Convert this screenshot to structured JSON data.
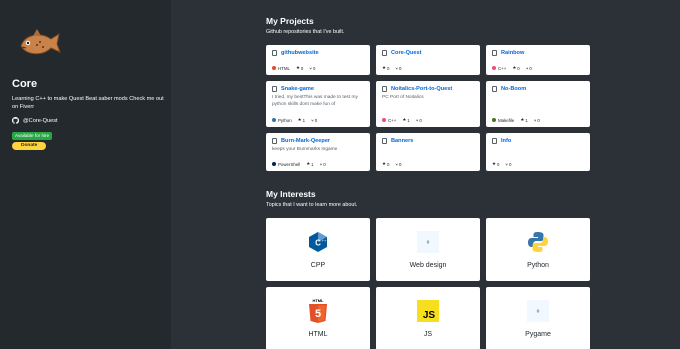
{
  "profile": {
    "name": "Core",
    "bio": "Learning C++ to make Quest Beat saber mods Check me out on Fiverr",
    "github": "@Core-Quest",
    "hire": "Available for hire",
    "donate": "Donate"
  },
  "projects": {
    "title": "My Projects",
    "subtitle": "Github repositories that I've built.",
    "items": [
      {
        "name": "githubwebsite",
        "desc": "",
        "lang": "HTML",
        "lang_color": "#e34c26",
        "stars": "0",
        "forks": "0"
      },
      {
        "name": "Core-Quest",
        "desc": "",
        "lang": "",
        "lang_color": "",
        "stars": "0",
        "forks": "0"
      },
      {
        "name": "Rainbow",
        "desc": "",
        "lang": "C++",
        "lang_color": "#f34b7d",
        "stars": "0",
        "forks": "0"
      },
      {
        "name": "Snake-game",
        "desc": "I tried, my bestThis was made to test my python skills dont make fun of",
        "lang": "Python",
        "lang_color": "#3572A5",
        "stars": "1",
        "forks": "0"
      },
      {
        "name": "Noitalics-Port-to-Quest",
        "desc": "PC Port of Noitalics",
        "lang": "C++",
        "lang_color": "#f34b7d",
        "stars": "1",
        "forks": "0"
      },
      {
        "name": "No-Boom",
        "desc": "",
        "lang": "Makefile",
        "lang_color": "#427819",
        "stars": "1",
        "forks": "0"
      },
      {
        "name": "Burn-Mark-Qeeper",
        "desc": "keeps your Burnmarks Ingame",
        "lang": "PowerShell",
        "lang_color": "#012456",
        "stars": "1",
        "forks": "0"
      },
      {
        "name": "Banners",
        "desc": "",
        "lang": "",
        "lang_color": "",
        "stars": "0",
        "forks": "0"
      },
      {
        "name": "Info",
        "desc": "",
        "lang": "",
        "lang_color": "",
        "stars": "0",
        "forks": "0"
      }
    ]
  },
  "interests": {
    "title": "My Interests",
    "subtitle": "Topics that I want to learn more about.",
    "items": [
      {
        "label": "CPP",
        "icon": "cpp-icon"
      },
      {
        "label": "Web design",
        "icon": "web-design-icon"
      },
      {
        "label": "Python",
        "icon": "python-icon"
      },
      {
        "label": "HTML",
        "icon": "html5-icon"
      },
      {
        "label": "JS",
        "icon": "js-icon"
      },
      {
        "label": "Pygame",
        "icon": "pygame-icon"
      }
    ]
  },
  "colors": {
    "sidebar": "#24292e",
    "main": "#2b3137",
    "link": "#0366d6",
    "hire": "#28a745",
    "donate": "#ffd33d"
  }
}
